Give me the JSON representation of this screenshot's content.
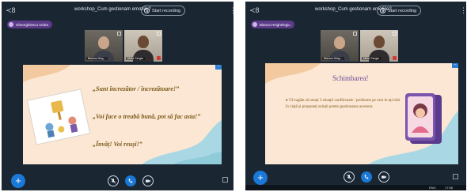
{
  "left": {
    "meeting_title": "workshop_Cum gestionam emotiile?",
    "record_label": "Start recording",
    "presenter_name": "Gheorghiescu Andra",
    "cams": [
      {
        "label": "Bianca Heg..."
      },
      {
        "label": "Miha Sergiu"
      }
    ],
    "slide": {
      "line1": "„Sunt încrezător / încrezătoare!”",
      "line2": "„Voi face o treabă bună, pot să fac asta!”",
      "line3": "„Învăț! Voi reuși!”"
    }
  },
  "right": {
    "meeting_title": "workshop_Cum gestionam emotiile?",
    "record_label": "Start recording",
    "presenter_name": "Bianca Heighelegiu",
    "cams": [
      {
        "label": "Bianca Heig..."
      },
      {
        "label": "Miha Sergiu"
      }
    ],
    "slide": {
      "title": "Schimbarea!",
      "body": "♦ Vă rugăm să notați 3 situații conflictuale / probleme pe care le-ați trăit în viață și propuneți soluții pentru gestionarea acestora."
    },
    "taskbar": {
      "time": "17:58",
      "tray": "ENG"
    }
  },
  "colors": {
    "app_bg": "#1b2633",
    "slide_bg": "#fbe7d3",
    "accent_blue": "#1a78d6",
    "presenter_purple": "#5b3a8a",
    "slide_title_purple": "#6a4a9a",
    "slide_text_gold": "#7a5a1a"
  },
  "icons": [
    "users-icon",
    "record-icon",
    "kebab-menu-icon",
    "mic-icon",
    "expand-icon",
    "plus-icon",
    "mute-icon",
    "phone-icon",
    "camera-icon"
  ]
}
